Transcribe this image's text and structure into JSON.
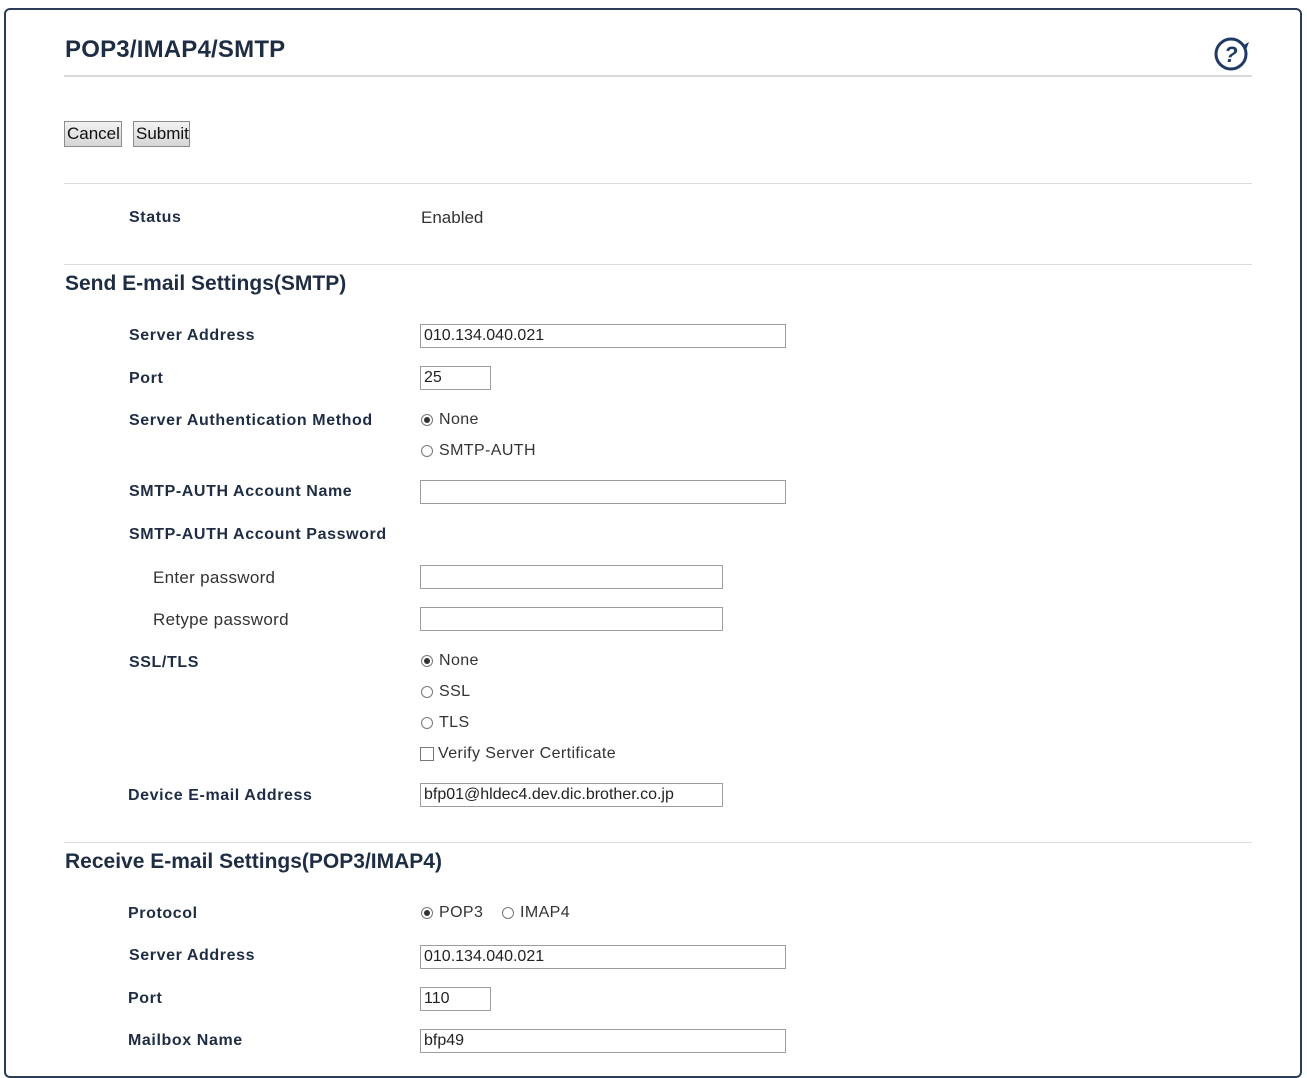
{
  "page": {
    "title": "POP3/IMAP4/SMTP",
    "help_icon": "help-icon"
  },
  "toolbar": {
    "cancel_label": "Cancel",
    "submit_label": "Submit"
  },
  "status": {
    "label": "Status",
    "value": "Enabled"
  },
  "send": {
    "heading": "Send E-mail Settings(SMTP)",
    "server_address": {
      "label": "Server Address",
      "value": "010.134.040.021"
    },
    "port": {
      "label": "Port",
      "value": "25"
    },
    "auth_method": {
      "label": "Server Authentication Method",
      "options": [
        "None",
        "SMTP-AUTH"
      ],
      "selected": "None"
    },
    "account_name": {
      "label": "SMTP-AUTH Account Name",
      "value": ""
    },
    "account_password": {
      "label": "SMTP-AUTH Account Password",
      "enter_label": "Enter password",
      "retype_label": "Retype password"
    },
    "ssl_tls": {
      "label": "SSL/TLS",
      "options": [
        "None",
        "SSL",
        "TLS"
      ],
      "selected": "None",
      "verify_label": "Verify Server Certificate",
      "verify_checked": false
    },
    "device_email": {
      "label": "Device E-mail Address",
      "value": "bfp01@hldec4.dev.dic.brother.co.jp"
    }
  },
  "receive": {
    "heading": "Receive E-mail Settings(POP3/IMAP4)",
    "protocol": {
      "label": "Protocol",
      "options": [
        "POP3",
        "IMAP4"
      ],
      "selected": "POP3"
    },
    "server_address": {
      "label": "Server Address",
      "value": "010.134.040.021"
    },
    "port": {
      "label": "Port",
      "value": "110"
    },
    "mailbox": {
      "label": "Mailbox Name",
      "value": "bfp49"
    }
  }
}
